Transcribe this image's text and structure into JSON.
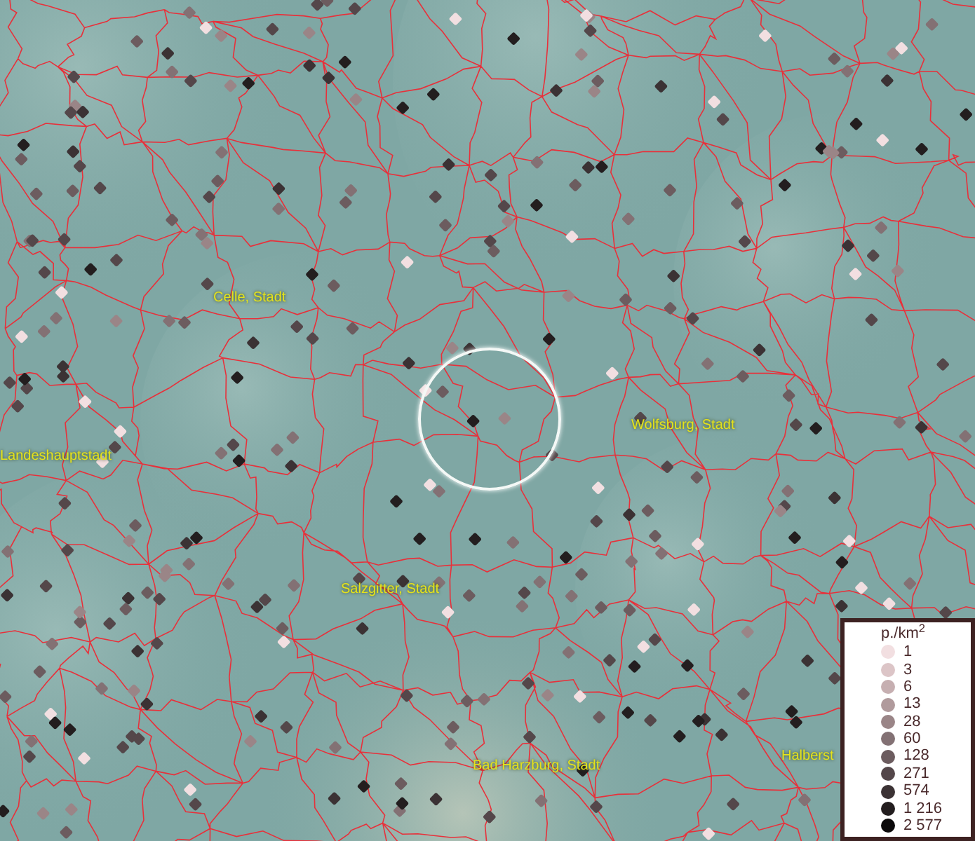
{
  "map": {
    "labels": [
      {
        "text": "Celle, Stadt"
      },
      {
        "text": "Landeshauptstadt"
      },
      {
        "text": "Wolfsburg, Stadt"
      },
      {
        "text": "Salzgitter, Stadt"
      },
      {
        "text": "Bad Harzburg, Stadt"
      },
      {
        "text": "Halberst"
      }
    ]
  },
  "legend": {
    "title": "p./km$^{2}$",
    "items": [
      {
        "label": "1",
        "color": "#f2dfe1"
      },
      {
        "label": "3",
        "color": "#dcc5c7"
      },
      {
        "label": "6",
        "color": "#c6afb1"
      },
      {
        "label": "13",
        "color": "#b09a9c"
      },
      {
        "label": "28",
        "color": "#9a8587"
      },
      {
        "label": "60",
        "color": "#837174"
      },
      {
        "label": "128",
        "color": "#6c5c5f"
      },
      {
        "label": "271",
        "color": "#54474a"
      },
      {
        "label": "574",
        "color": "#3b3234"
      },
      {
        "label": "1 216",
        "color": "#231e1f"
      },
      {
        "label": "2 577",
        "color": "#0c0a0b"
      }
    ]
  }
}
